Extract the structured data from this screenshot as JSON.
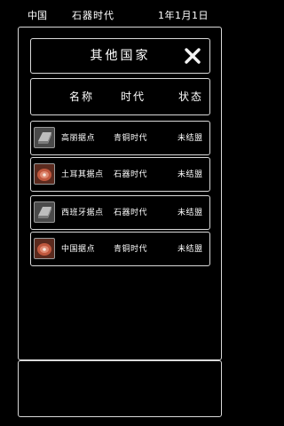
{
  "topbar": {
    "country": "中国",
    "era": "石器时代",
    "date": "1年1月1日"
  },
  "dialog": {
    "title": "其他国家",
    "close_icon": "close-icon",
    "columns": {
      "name": "名称",
      "era": "时代",
      "status": "状态"
    },
    "rows": [
      {
        "icon": "iron-ingot-icon",
        "name": "高丽据点",
        "era": "青铜时代",
        "status": "未结盟"
      },
      {
        "icon": "meat-icon",
        "name": "土耳其据点",
        "era": "石器时代",
        "status": "未结盟"
      },
      {
        "icon": "iron-ingot-icon",
        "name": "西班牙据点",
        "era": "石器时代",
        "status": "未结盟"
      },
      {
        "icon": "meat-icon",
        "name": "中国据点",
        "era": "青铜时代",
        "status": "未结盟"
      }
    ]
  },
  "colors": {
    "background": "#000000",
    "border": "#d9d9d9",
    "text": "#ffffff"
  }
}
